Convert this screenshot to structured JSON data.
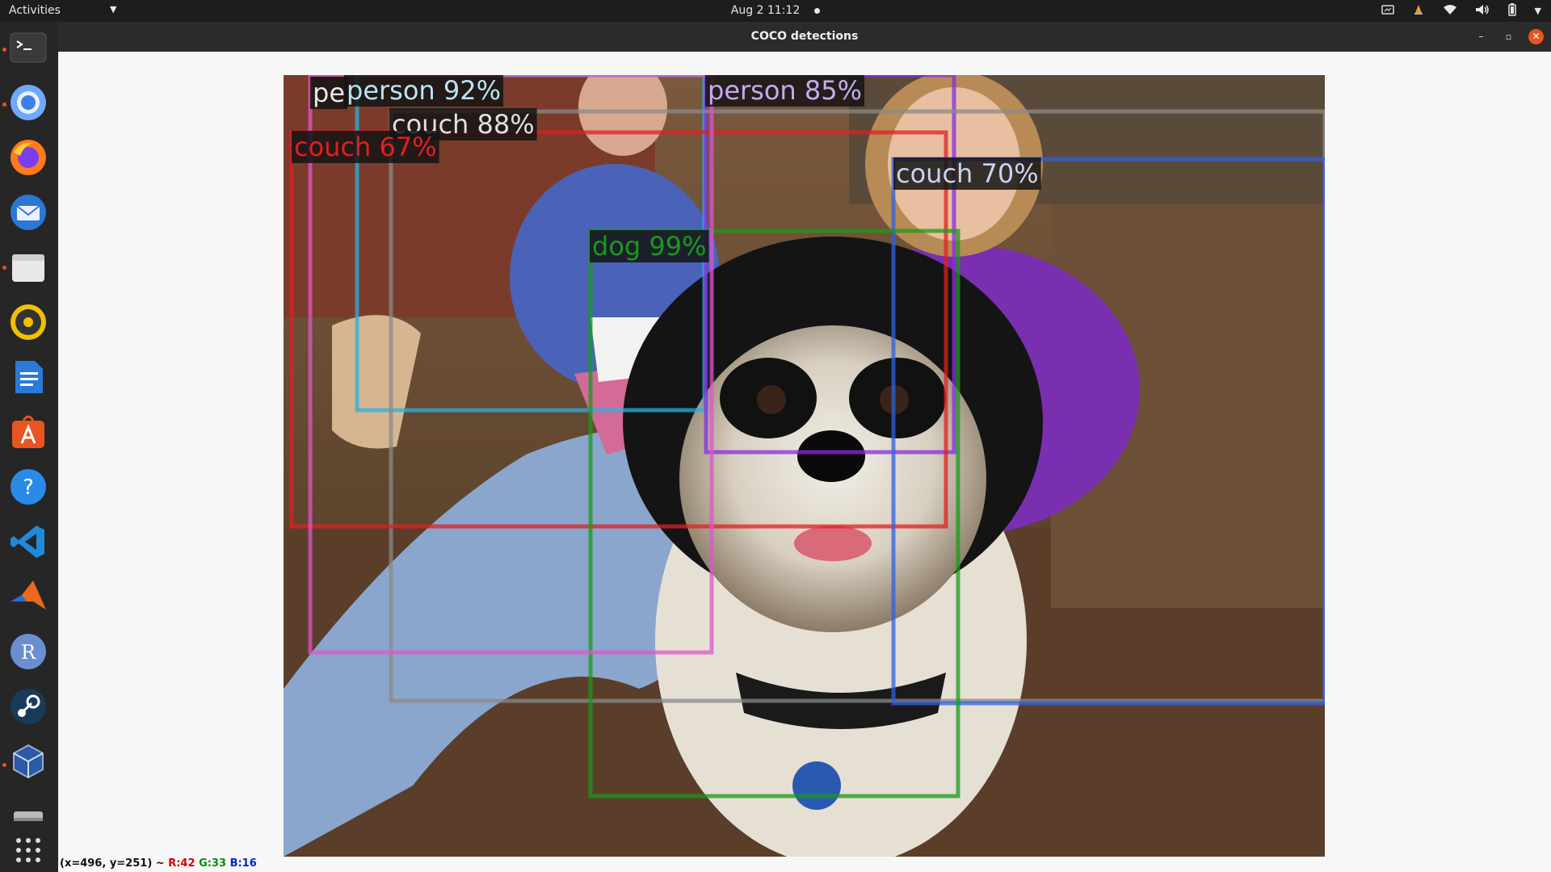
{
  "topbar": {
    "activities": "Activities",
    "app_menu_arrow": "▼",
    "clock": "Aug 2  11:12"
  },
  "dock": {
    "items": [
      {
        "name": "terminal",
        "icon": "terminal-icon",
        "running": true
      },
      {
        "name": "chromium",
        "icon": "chromium-icon",
        "running": true
      },
      {
        "name": "firefox",
        "icon": "firefox-icon",
        "running": false
      },
      {
        "name": "thunderbird",
        "icon": "thunderbird-icon",
        "running": false
      },
      {
        "name": "files",
        "icon": "files-icon",
        "running": true
      },
      {
        "name": "rhythmbox",
        "icon": "rhythmbox-icon",
        "running": false
      },
      {
        "name": "libreoffice-writer",
        "icon": "writer-icon",
        "running": false
      },
      {
        "name": "ubuntu-software",
        "icon": "software-icon",
        "running": false
      },
      {
        "name": "help",
        "icon": "help-icon",
        "running": false
      },
      {
        "name": "vscode",
        "icon": "vscode-icon",
        "running": false
      },
      {
        "name": "matlab",
        "icon": "matlab-icon",
        "running": false
      },
      {
        "name": "r",
        "icon": "r-icon",
        "running": false
      },
      {
        "name": "steam",
        "icon": "steam-icon",
        "running": false
      },
      {
        "name": "virtualbox",
        "icon": "virtualbox-icon",
        "running": true
      },
      {
        "name": "drive",
        "icon": "drive-icon",
        "running": false
      },
      {
        "name": "show-applications",
        "icon": "grid-icon",
        "running": false
      }
    ]
  },
  "window": {
    "title": "COCO detections",
    "minimize": "–",
    "maximize": "▫",
    "close": "✕"
  },
  "detections": [
    {
      "label": "person 92%",
      "color": "#2ab0e0"
    },
    {
      "label": "person 85%",
      "color": "#8a2be2"
    },
    {
      "label": "couch 88%",
      "color": "#8a8a8a"
    },
    {
      "label": "couch 67%",
      "color": "#e02020"
    },
    {
      "label": "couch 70%",
      "color": "#3060e0"
    },
    {
      "label": "dog 99%",
      "color": "#1a9a1a"
    },
    {
      "label": "pe",
      "color": "#dd55cc"
    }
  ],
  "status": {
    "coords": "(x=496, y=251) ~ ",
    "r": "R:42",
    "g": "G:33",
    "b": "B:16"
  },
  "colors": {
    "accent": "#e95420",
    "topbar_bg": "#1d1d1d",
    "dock_bg": "#262626"
  }
}
